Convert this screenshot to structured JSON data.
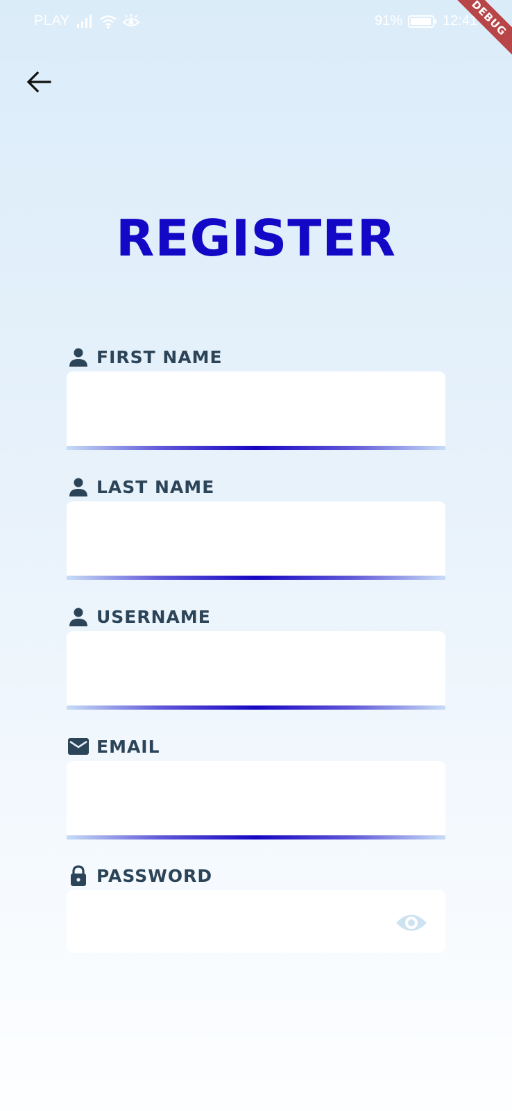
{
  "status_bar": {
    "carrier": "PLAY",
    "battery": "91%",
    "time": "12:41",
    "icons": [
      "signal-icon",
      "wifi-icon",
      "eye-comfort-icon",
      "battery-icon"
    ]
  },
  "debug_banner": "DEBUG",
  "header": {
    "back_icon": "arrow-left-icon"
  },
  "title": "REGISTER",
  "colors": {
    "title": "#1408c7",
    "label": "#2c4457",
    "underline_accent": "#1606c2",
    "eye_icon": "#cde3f1",
    "debug_ribbon": "#b84548"
  },
  "form": {
    "first_name": {
      "label": "FIRST NAME",
      "icon": "person-icon",
      "value": ""
    },
    "last_name": {
      "label": "LAST NAME",
      "icon": "person-icon",
      "value": ""
    },
    "username": {
      "label": "USERNAME",
      "icon": "person-icon",
      "value": ""
    },
    "email": {
      "label": "EMAIL",
      "icon": "mail-icon",
      "value": ""
    },
    "password": {
      "label": "PASSWORD",
      "icon": "lock-icon",
      "value": "",
      "toggle_icon": "eye-icon"
    }
  }
}
